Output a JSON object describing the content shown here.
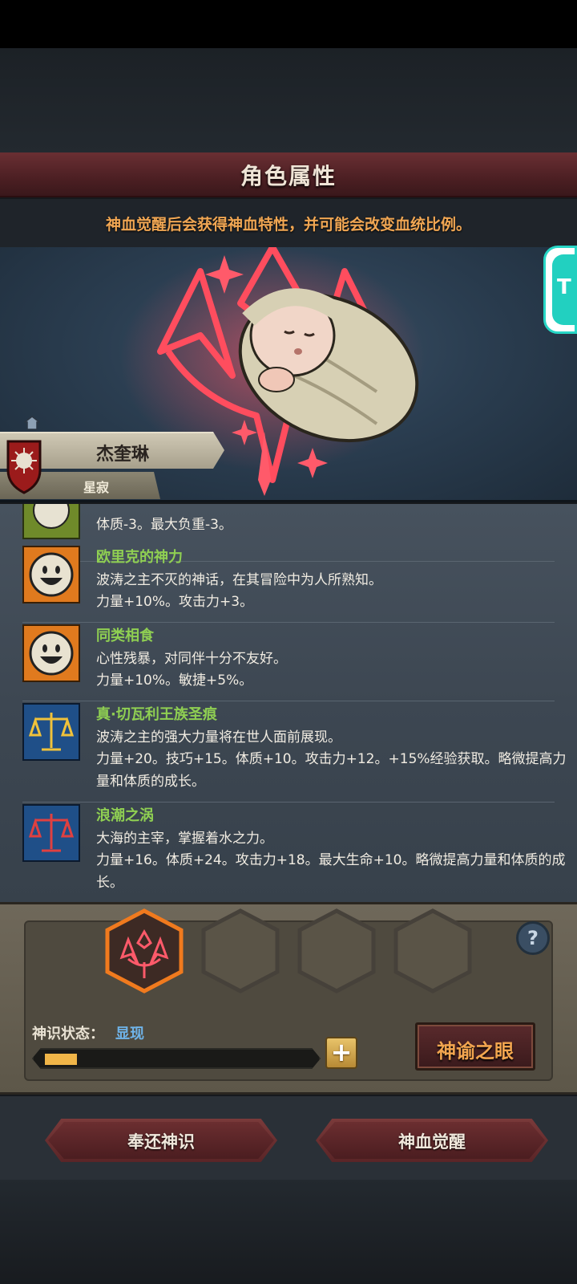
{
  "header": {
    "title": "角色属性",
    "subtitle": "神血觉醒后会获得神血特性，并可能会改变血统比例。"
  },
  "character": {
    "name": "杰奎琳",
    "rank": "星寂"
  },
  "side_tab": {
    "label": "T"
  },
  "traits": [
    {
      "name": "",
      "description": "",
      "effects": "体质-3。最大负重-3。",
      "icon": "face-icon",
      "color": "#6f8a2a"
    },
    {
      "name": "欧里克的神力",
      "description": "波涛之主不灭的神话，在其冒险中为人所熟知。",
      "effects": "力量+10%。攻击力+3。",
      "icon": "smiley-icon",
      "color": "#e07a1e"
    },
    {
      "name": "同类相食",
      "description": "心性残暴，对同伴十分不友好。",
      "effects": "力量+10%。敏捷+5%。",
      "icon": "smiley-icon",
      "color": "#e07a1e"
    },
    {
      "name": "真·切瓦利王族圣痕",
      "description": "波涛之主的强大力量将在世人面前展现。",
      "effects": "力量+20。技巧+15。体质+10。攻击力+12。+15%经验获取。略微提高力量和体质的成长。",
      "icon": "scales-gold-icon",
      "color": "#2a6fb0"
    },
    {
      "name": "浪潮之涡",
      "description": "大海的主宰，掌握着水之力。",
      "effects": "力量+16。体质+24。攻击力+18。最大生命+10。略微提高力量和体质的成长。",
      "icon": "scales-red-icon",
      "color": "#2a6fb0"
    }
  ],
  "bloodline": {
    "help": "?",
    "state_label": "神识状态：",
    "state_value": "显现",
    "progress": 0.12,
    "plus": "+",
    "oracle_button": "神谕之眼"
  },
  "actions": {
    "return_button": "奉还神识",
    "awaken_button": "神血觉醒"
  }
}
